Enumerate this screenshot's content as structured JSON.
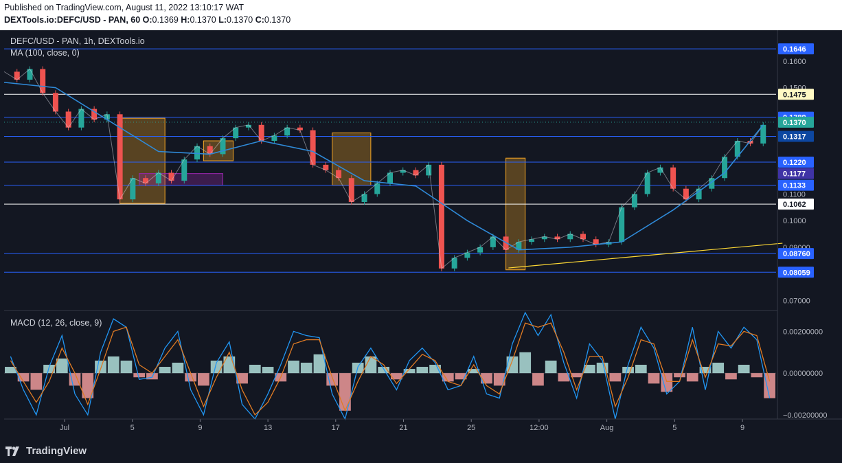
{
  "header": {
    "published": "Published on TradingView.com, August 11, 2022 13:10:17 WAT",
    "symbol": "DEXTools.io:DEFC/USD - PAN, 60",
    "ohlc": {
      "o": "0.1369",
      "h": "0.1370",
      "l": "0.1370",
      "c": "0.1370"
    }
  },
  "footer": {
    "brand": "TradingView"
  },
  "chart_data": [
    {
      "type": "line",
      "pane": "price",
      "legend_title": "DEFC/USD - PAN, 1h, DEXTools.io",
      "indicator_label": "MA (100, close, 0)",
      "x_ticks": [
        "Jul",
        "5",
        "9",
        "13",
        "17",
        "21",
        "25",
        "12:00",
        "Aug",
        "5",
        "9"
      ],
      "y_ticks": [
        "0.1600",
        "0.1500",
        "0.1100",
        "0.1000",
        "0.09000",
        "0.07000"
      ],
      "ylim": [
        0.0662,
        0.1716
      ],
      "levels": [
        {
          "label": "0.1646",
          "value": 0.1646,
          "color": "#2962ff"
        },
        {
          "label": "0.1475",
          "value": 0.1475,
          "color": "#fff9c4"
        },
        {
          "label": "0.1389",
          "value": 0.1389,
          "color": "#2962ff"
        },
        {
          "label": "0.1370",
          "value": 0.137,
          "color": "#26a69a"
        },
        {
          "label": "0.1317",
          "value": 0.1317,
          "color": "#0d47a1"
        },
        {
          "label": "0.1220",
          "value": 0.122,
          "color": "#2962ff"
        },
        {
          "label": "0.1177",
          "value": 0.1177,
          "color": "#3f33a6"
        },
        {
          "label": "0.1133",
          "value": 0.1133,
          "color": "#2962ff"
        },
        {
          "label": "0.1062",
          "value": 0.1062,
          "color": "#ffffff"
        },
        {
          "label": "0.08760",
          "value": 0.0876,
          "color": "#2962ff"
        },
        {
          "label": "0.08059",
          "value": 0.08059,
          "color": "#2962ff"
        }
      ],
      "series": [
        {
          "name": "DEFC/USD close",
          "color": "#d1d4dc",
          "x": [
            0,
            1,
            2,
            3,
            4,
            5,
            6,
            7,
            8,
            9,
            10,
            11,
            12,
            13,
            14,
            15,
            16,
            17,
            18,
            19,
            20,
            21,
            22,
            23,
            24,
            25,
            26,
            27,
            28,
            29,
            30,
            31,
            32,
            33,
            34,
            35,
            36,
            37,
            38,
            39,
            40,
            41,
            42,
            43,
            44,
            45,
            46,
            47,
            48,
            49,
            50,
            51,
            52,
            53,
            54,
            55,
            56,
            57,
            58,
            59
          ],
          "y": [
            0.156,
            0.153,
            0.157,
            0.148,
            0.141,
            0.135,
            0.142,
            0.138,
            0.14,
            0.108,
            0.116,
            0.114,
            0.118,
            0.115,
            0.123,
            0.128,
            0.125,
            0.131,
            0.135,
            0.136,
            0.13,
            0.132,
            0.135,
            0.134,
            0.121,
            0.119,
            0.116,
            0.107,
            0.11,
            0.114,
            0.118,
            0.119,
            0.117,
            0.121,
            0.082,
            0.086,
            0.088,
            0.09,
            0.094,
            0.089,
            0.092,
            0.093,
            0.094,
            0.093,
            0.095,
            0.093,
            0.091,
            0.092,
            0.105,
            0.11,
            0.118,
            0.12,
            0.112,
            0.108,
            0.112,
            0.116,
            0.124,
            0.13,
            0.129,
            0.136
          ]
        },
        {
          "name": "MA (100, close, 0)",
          "color": "#2f8ad8",
          "x": [
            0,
            4,
            8,
            12,
            16,
            20,
            24,
            28,
            32,
            36,
            40,
            44,
            48,
            52,
            56,
            59
          ],
          "y": [
            0.152,
            0.15,
            0.138,
            0.126,
            0.125,
            0.13,
            0.126,
            0.115,
            0.113,
            0.1,
            0.089,
            0.09,
            0.092,
            0.104,
            0.118,
            0.136
          ]
        }
      ]
    },
    {
      "type": "bar",
      "pane": "macd",
      "indicator_label": "MACD (12, 26, close, 9)",
      "y_ticks": [
        "0.00200000",
        "0.00000000",
        "−0.00200000"
      ],
      "ylim": [
        -0.0022,
        0.003
      ],
      "series": [
        {
          "name": "Histogram",
          "values": [
            0.0003,
            -0.0004,
            -0.0008,
            0.0004,
            0.0007,
            -0.0006,
            -0.0012,
            0.0006,
            0.0008,
            0.0006,
            -0.0002,
            -0.0003,
            0.0003,
            0.0005,
            -0.0004,
            -0.0006,
            0.0006,
            0.0008,
            -0.0005,
            0.0004,
            0.0003,
            -0.0004,
            0.0006,
            0.0005,
            0.0009,
            -0.0006,
            -0.0018,
            0.0005,
            0.0008,
            0.0003,
            -0.0003,
            0.0002,
            0.0003,
            0.0004,
            -0.0004,
            -0.0003,
            0.0002,
            -0.0005,
            -0.0006,
            0.0008,
            0.001,
            -0.0006,
            0.0006,
            -0.0004,
            -0.0002,
            0.0004,
            0.0005,
            -0.0004,
            0.0003,
            0.0004,
            -0.0005,
            -0.0009,
            -0.0002,
            -0.0004,
            0.0003,
            0.0005,
            -0.0003,
            0.0004,
            -0.0002,
            -0.0012
          ]
        },
        {
          "name": "MACD",
          "color": "#2196f3",
          "values": [
            0.0008,
            -0.0008,
            -0.002,
            0.0003,
            0.0018,
            -0.001,
            -0.002,
            0.001,
            0.0026,
            0.0022,
            -0.0003,
            -0.0002,
            0.0012,
            0.002,
            -0.0008,
            -0.002,
            0.0005,
            0.0015,
            -0.0015,
            -0.0022,
            -0.001,
            0.0004,
            0.002,
            0.0018,
            0.0017,
            -0.001,
            -0.0022,
            0.0003,
            0.0012,
            0.0002,
            -0.0008,
            0.0006,
            0.0012,
            0.0005,
            -0.0008,
            -0.0006,
            0.0008,
            -0.001,
            -0.0012,
            0.0014,
            0.0029,
            0.0018,
            0.0028,
            0.0005,
            -0.0012,
            0.0014,
            0.0006,
            -0.0022,
            0.0004,
            0.0022,
            0.0012,
            -0.001,
            -0.0004,
            0.0022,
            -0.0008,
            0.002,
            0.0012,
            0.0022,
            0.0016,
            -0.0012
          ]
        },
        {
          "name": "Signal",
          "color": "#e07b24",
          "values": [
            0.0006,
            -0.0004,
            -0.0014,
            -0.0004,
            0.0012,
            0.0,
            -0.0015,
            0.0002,
            0.002,
            0.0022,
            0.0004,
            0.0,
            0.0008,
            0.0016,
            0.0,
            -0.0016,
            -0.0002,
            0.001,
            -0.0008,
            -0.002,
            -0.0014,
            -0.0002,
            0.0014,
            0.0016,
            0.0016,
            -0.0002,
            -0.0018,
            -0.0004,
            0.0008,
            0.0004,
            -0.0005,
            0.0002,
            0.0009,
            0.0006,
            -0.0004,
            -0.0006,
            0.0004,
            -0.0006,
            -0.001,
            0.0006,
            0.0024,
            0.0022,
            0.0024,
            0.001,
            -0.0008,
            0.0008,
            0.0008,
            -0.0016,
            -0.0002,
            0.0016,
            0.0014,
            -0.0004,
            -0.0004,
            0.0016,
            -0.0002,
            0.0014,
            0.0013,
            0.002,
            0.0018,
            -0.0004
          ]
        }
      ]
    }
  ],
  "zones": [
    {
      "label": "zone-1",
      "x0": 9,
      "x1": 12.5,
      "y0": 0.1065,
      "y1": 0.1385,
      "color": "#f9a825"
    },
    {
      "label": "zone-2",
      "x0": 15.5,
      "x1": 17.8,
      "y0": 0.1225,
      "y1": 0.13,
      "color": "#f9a825"
    },
    {
      "label": "zone-3",
      "x0": 25.5,
      "x1": 28.5,
      "y0": 0.1133,
      "y1": 0.133,
      "color": "#f9a825"
    },
    {
      "label": "zone-4",
      "x0": 39,
      "x1": 40.5,
      "y0": 0.0815,
      "y1": 0.1235,
      "color": "#f9a825"
    },
    {
      "label": "zone-5",
      "x0": 10.5,
      "x1": 17,
      "y0": 0.1133,
      "y1": 0.1177,
      "color": "#9c27b0"
    }
  ],
  "trendline": {
    "x0": 39.2,
    "y0": 0.0822,
    "x1": 60.5,
    "y1": 0.0915,
    "color": "#fdd835"
  }
}
